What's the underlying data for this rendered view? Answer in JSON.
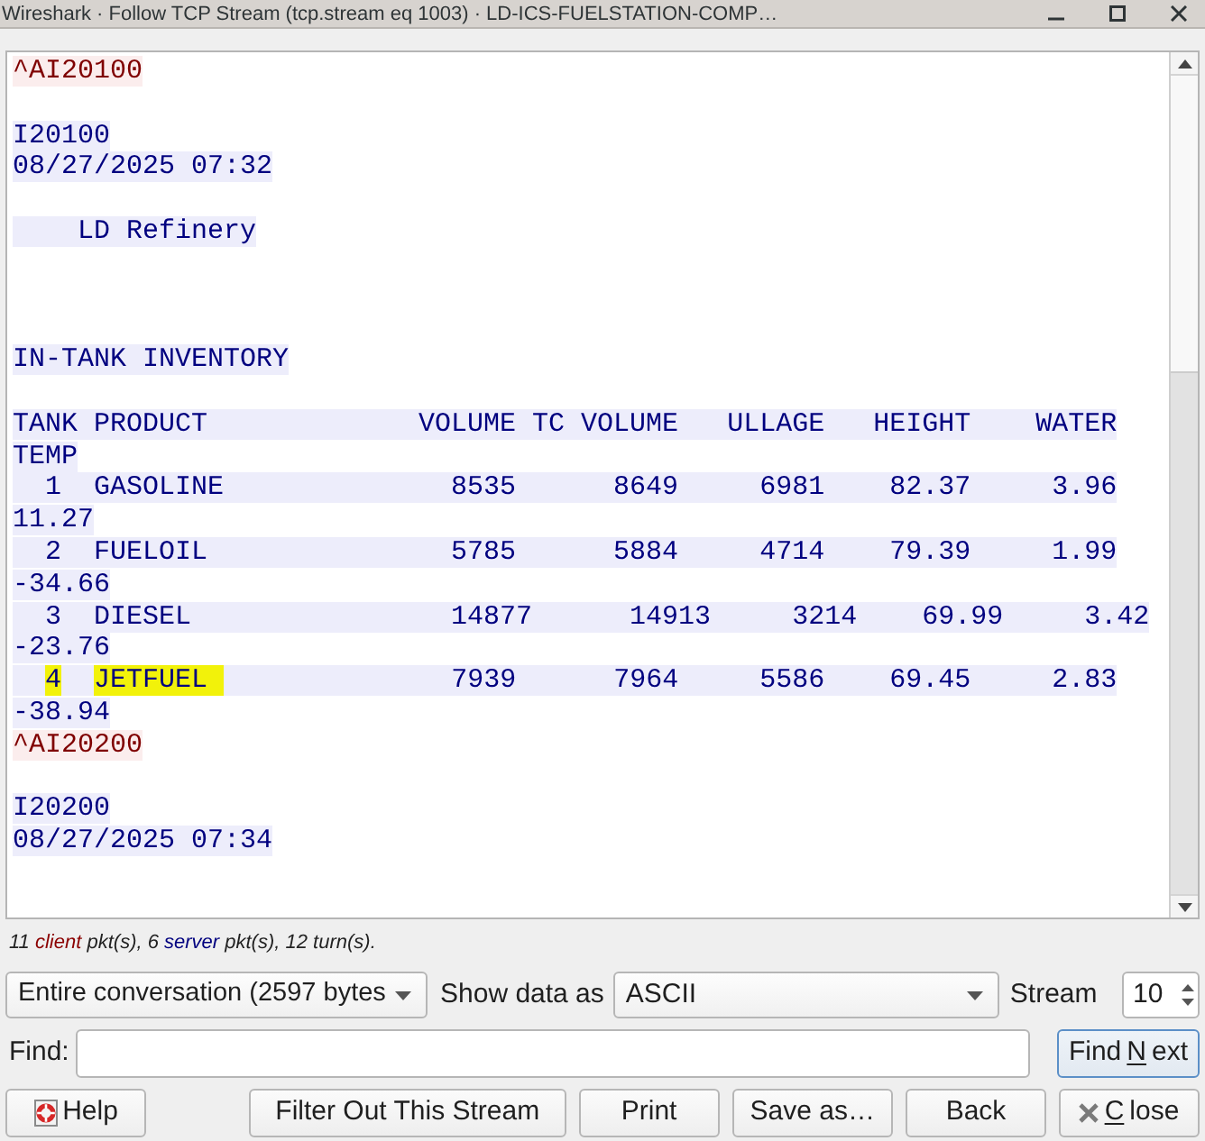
{
  "window": {
    "title": "Wireshark · Follow TCP Stream (tcp.stream eq 1003) · LD-ICS-FUELSTATION-COMP…"
  },
  "stream_view": {
    "lines": [
      {
        "kind": "client",
        "text": "^AI20100"
      },
      {
        "kind": "blank"
      },
      {
        "kind": "server",
        "text": "I20100"
      },
      {
        "kind": "server",
        "text": "08/27/2025 07:32"
      },
      {
        "kind": "blank"
      },
      {
        "kind": "server",
        "text": "    LD Refinery"
      },
      {
        "kind": "blank"
      },
      {
        "kind": "blank"
      },
      {
        "kind": "blank"
      },
      {
        "kind": "server",
        "text": "IN-TANK INVENTORY"
      },
      {
        "kind": "blank"
      },
      {
        "kind": "server",
        "text": "TANK PRODUCT             VOLUME TC VOLUME   ULLAGE   HEIGHT    WATER"
      },
      {
        "kind": "server",
        "text": "TEMP"
      },
      {
        "kind": "server",
        "text": "  1  GASOLINE              8535      8649     6981    82.37     3.96"
      },
      {
        "kind": "server",
        "text": "11.27"
      },
      {
        "kind": "server",
        "text": "  2  FUELOIL               5785      5884     4714    79.39     1.99"
      },
      {
        "kind": "server",
        "text": "-34.66"
      },
      {
        "kind": "server",
        "text": "  3  DIESEL                14877      14913     3214    69.99     3.42"
      },
      {
        "kind": "server",
        "text": "-23.76"
      },
      {
        "kind": "server",
        "segments": [
          {
            "text": "  4",
            "highlighted": true
          },
          {
            "text": "  JETFUEL ",
            "highlighted": true
          },
          {
            "text": "              7939      7964     5586    69.45     2.83",
            "highlighted": false
          }
        ]
      },
      {
        "kind": "server",
        "text": "-38.94"
      },
      {
        "kind": "client",
        "text": "^AI20200"
      },
      {
        "kind": "blank"
      },
      {
        "kind": "server",
        "text": "I20200"
      },
      {
        "kind": "server",
        "text": "08/27/2025 07:34"
      }
    ]
  },
  "summary": [
    {
      "kind": "plain",
      "text": "11 "
    },
    {
      "kind": "client",
      "text": "client"
    },
    {
      "kind": "plain",
      "text": " pkt(s), 6 "
    },
    {
      "kind": "server",
      "text": "server"
    },
    {
      "kind": "plain",
      "text": " pkt(s), 12 turn(s)."
    }
  ],
  "conversation_dropdown": {
    "value": "Entire conversation (2597 bytes"
  },
  "show_data_as": {
    "label": "Show data as",
    "value": "ASCII"
  },
  "stream": {
    "label": "Stream",
    "value": "10"
  },
  "find": {
    "label": "Find:",
    "button": {
      "label_start": "Find ",
      "mnemonic": "N",
      "label_end": "ext",
      "focused": true
    }
  },
  "buttons": [
    {
      "kind": "help",
      "label": "Help"
    },
    {
      "kind": "plain",
      "label": "Filter Out This Stream"
    },
    {
      "kind": "plain",
      "label": "Print"
    },
    {
      "kind": "plain",
      "label": "Save as…"
    },
    {
      "kind": "plain",
      "label": "Back"
    },
    {
      "kind": "close",
      "mnemonic": "C",
      "label_end": "lose"
    }
  ]
}
